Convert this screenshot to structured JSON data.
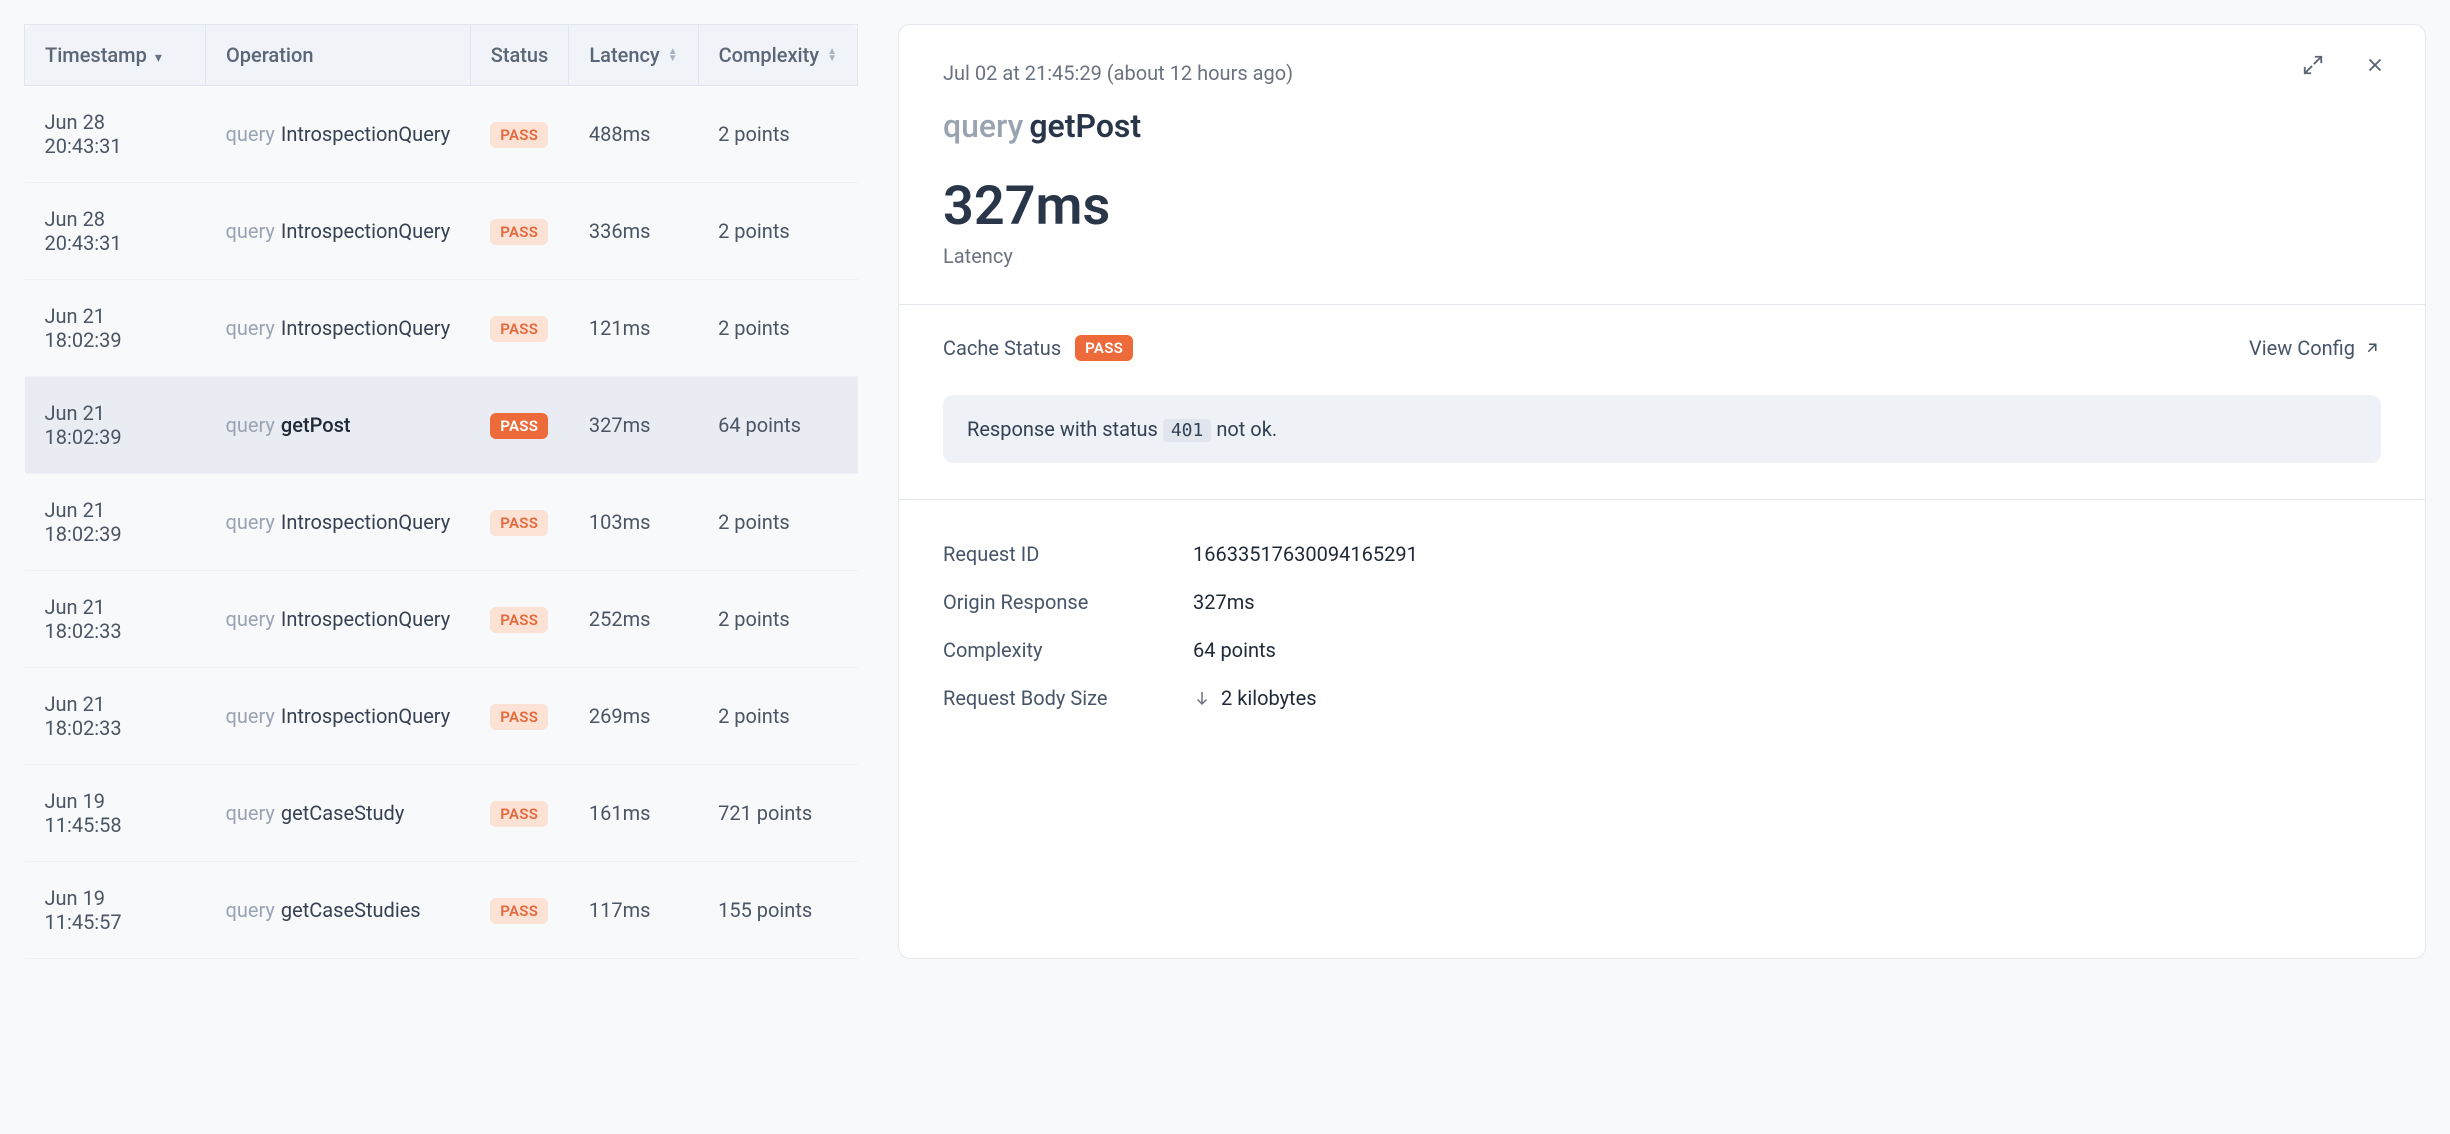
{
  "table": {
    "headers": {
      "timestamp": "Timestamp",
      "operation": "Operation",
      "status": "Status",
      "latency": "Latency",
      "complexity": "Complexity"
    },
    "rows": [
      {
        "timestamp": "Jun 28 20:43:31",
        "op_type": "query",
        "op_name": "IntrospectionQuery",
        "status": "PASS",
        "latency": "488ms",
        "complexity": "2 points",
        "selected": false
      },
      {
        "timestamp": "Jun 28 20:43:31",
        "op_type": "query",
        "op_name": "IntrospectionQuery",
        "status": "PASS",
        "latency": "336ms",
        "complexity": "2 points",
        "selected": false
      },
      {
        "timestamp": "Jun 21 18:02:39",
        "op_type": "query",
        "op_name": "IntrospectionQuery",
        "status": "PASS",
        "latency": "121ms",
        "complexity": "2 points",
        "selected": false
      },
      {
        "timestamp": "Jun 21 18:02:39",
        "op_type": "query",
        "op_name": "getPost",
        "status": "PASS",
        "latency": "327ms",
        "complexity": "64 points",
        "selected": true
      },
      {
        "timestamp": "Jun 21 18:02:39",
        "op_type": "query",
        "op_name": "IntrospectionQuery",
        "status": "PASS",
        "latency": "103ms",
        "complexity": "2 points",
        "selected": false
      },
      {
        "timestamp": "Jun 21 18:02:33",
        "op_type": "query",
        "op_name": "IntrospectionQuery",
        "status": "PASS",
        "latency": "252ms",
        "complexity": "2 points",
        "selected": false
      },
      {
        "timestamp": "Jun 21 18:02:33",
        "op_type": "query",
        "op_name": "IntrospectionQuery",
        "status": "PASS",
        "latency": "269ms",
        "complexity": "2 points",
        "selected": false
      },
      {
        "timestamp": "Jun 19 11:45:58",
        "op_type": "query",
        "op_name": "getCaseStudy",
        "status": "PASS",
        "latency": "161ms",
        "complexity": "721 points",
        "selected": false
      },
      {
        "timestamp": "Jun 19 11:45:57",
        "op_type": "query",
        "op_name": "getCaseStudies",
        "status": "PASS",
        "latency": "117ms",
        "complexity": "155 points",
        "selected": false
      }
    ]
  },
  "detail": {
    "timestamp_line": "Jul 02 at 21:45:29 (about 12 hours ago)",
    "query_type": "query",
    "query_name": "getPost",
    "latency_value": "327ms",
    "latency_label": "Latency",
    "cache_status_label": "Cache Status",
    "cache_status_badge": "PASS",
    "view_config_label": "View Config",
    "alert_prefix": "Response with status",
    "alert_code": "401",
    "alert_suffix": "not ok.",
    "kv": {
      "request_id_label": "Request ID",
      "request_id_value": "16633517630094165291",
      "origin_response_label": "Origin Response",
      "origin_response_value": "327ms",
      "complexity_label": "Complexity",
      "complexity_value": "64 points",
      "request_body_size_label": "Request Body Size",
      "request_body_size_value": "2 kilobytes"
    }
  }
}
